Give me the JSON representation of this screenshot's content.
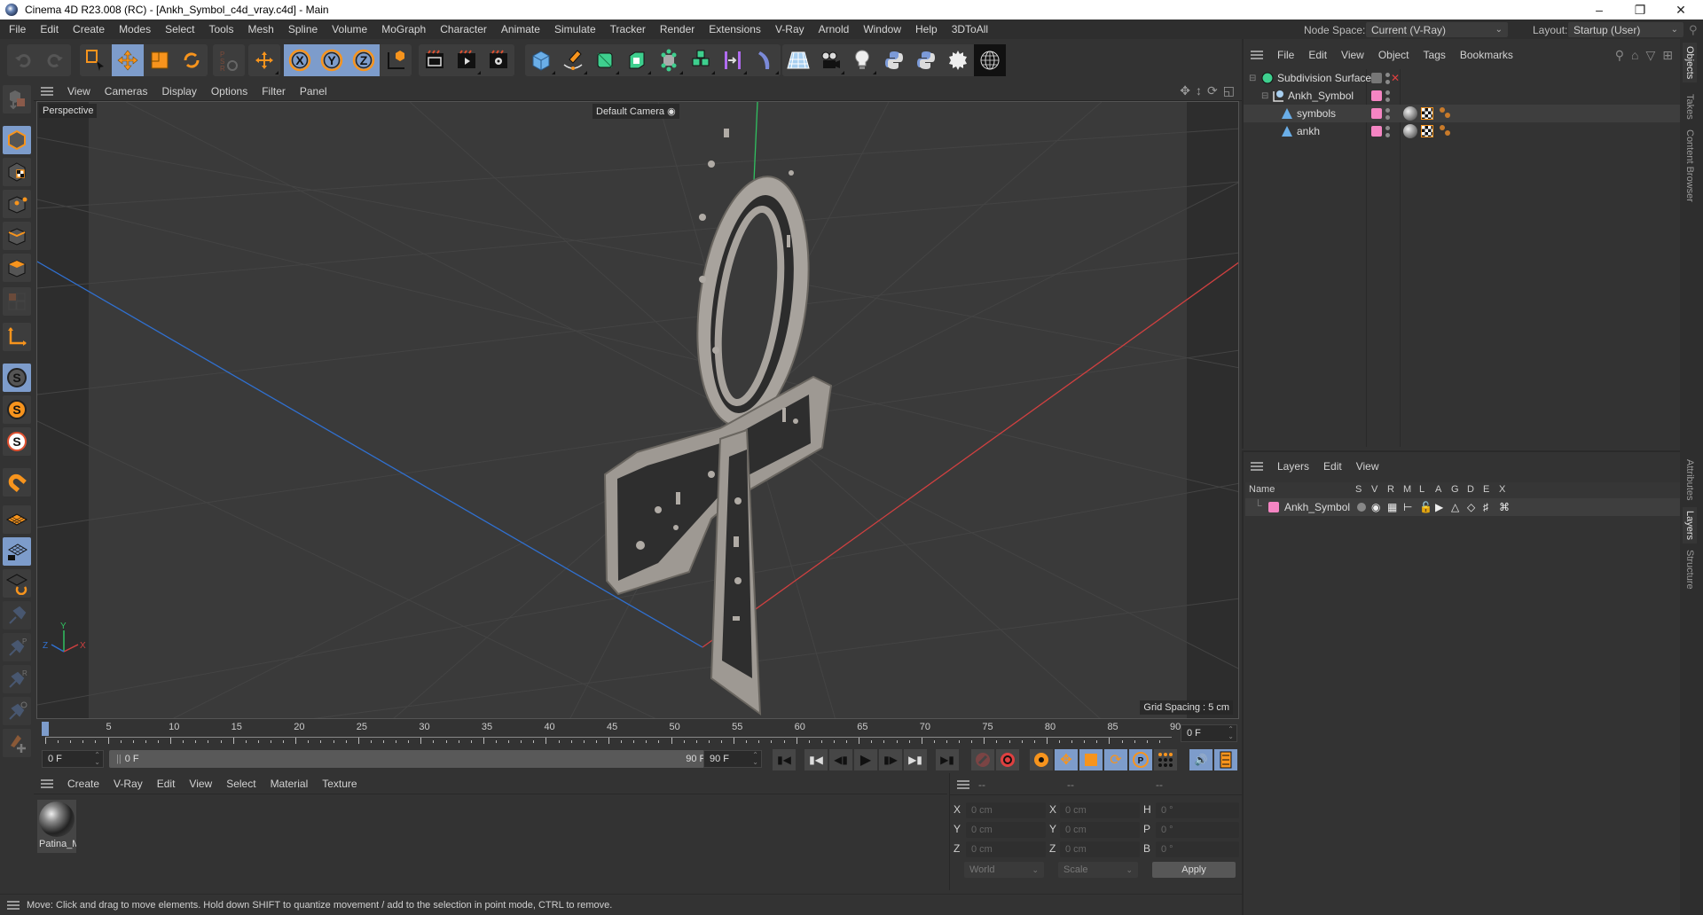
{
  "window": {
    "title": "Cinema 4D R23.008 (RC) - [Ankh_Symbol_c4d_vray.c4d] - Main",
    "controls": [
      "minimize",
      "maximize",
      "close"
    ]
  },
  "menubar": {
    "items": [
      "File",
      "Edit",
      "Create",
      "Modes",
      "Select",
      "Tools",
      "Mesh",
      "Spline",
      "Volume",
      "MoGraph",
      "Character",
      "Animate",
      "Simulate",
      "Tracker",
      "Render",
      "Extensions",
      "V-Ray",
      "Arnold",
      "Window",
      "Help",
      "3DToAll"
    ],
    "node_space_label": "Node Space:",
    "node_space_value": "Current (V-Ray)",
    "layout_label": "Layout:",
    "layout_value": "Startup (User)"
  },
  "toolbar": {
    "groups": [
      [
        "undo-icon",
        "redo-icon"
      ],
      [
        "live-selection-icon",
        "move-icon",
        "scale-icon",
        "rotate-icon"
      ],
      [
        "psr-icon"
      ],
      [
        "world-axis-move-icon"
      ],
      [
        "x-axis-lock-icon",
        "y-axis-lock-icon",
        "z-axis-lock-icon",
        "coordinate-system-icon"
      ],
      [
        "render-view-icon",
        "render-picture-viewer-icon",
        "render-settings-icon"
      ],
      [
        "cube-icon",
        "pen-icon",
        "subdivision-icon",
        "extrude-icon",
        "cloner-icon",
        "mograph-icon",
        "symmetry-icon",
        "deformer-icon"
      ],
      [
        "floor-icon",
        "camera-icon",
        "light-icon",
        "python-icon",
        "python-2-icon",
        "sun-icon",
        "sphere-wireframe-icon"
      ]
    ],
    "active": [
      "move-icon",
      "x-axis-lock-icon",
      "y-axis-lock-icon",
      "z-axis-lock-icon"
    ]
  },
  "left_tools": [
    "make-editable-icon",
    "model-mode-icon",
    "texture-mode-icon",
    "points-mode-icon",
    "edges-mode-icon",
    "polygons-mode-icon",
    "uv-mode-icon",
    "axis-mode-icon",
    "snap-icon",
    "snap-settings-icon",
    "snap-3d-icon",
    "magnet-icon",
    "workplane-icon",
    "workplane-lock-icon",
    "workplane-align-icon",
    "pin-icon",
    "pin-p-icon",
    "pin-r-icon",
    "pin-target-icon",
    "add-pin-icon"
  ],
  "viewport": {
    "menu": [
      "View",
      "Cameras",
      "Display",
      "Options",
      "Filter",
      "Panel"
    ],
    "view_name": "Perspective",
    "camera": "Default Camera",
    "grid_spacing": "Grid Spacing : 5 cm",
    "axis_labels": {
      "x": "X",
      "y": "Y",
      "z": "Z"
    },
    "nav_icons": [
      "pan-icon",
      "dolly-icon",
      "orbit-icon",
      "maximize-view-icon"
    ]
  },
  "timeline": {
    "ticks": [
      "0",
      "5",
      "10",
      "15",
      "20",
      "25",
      "30",
      "35",
      "40",
      "45",
      "50",
      "55",
      "60",
      "65",
      "70",
      "75",
      "80",
      "85",
      "90"
    ],
    "current_frame": "0 F",
    "start": "0 F",
    "range_start": "0 F",
    "range_end": "90 F",
    "end": "90 F",
    "frame_display": "0 F"
  },
  "transport": [
    "go-to-start-icon",
    "prev-key-icon",
    "prev-frame-icon",
    "play-icon",
    "next-frame-icon",
    "next-key-icon",
    "go-to-end-icon",
    "record-icon",
    "autokey-icon",
    "keyframe-settings-icon",
    "key-pos-icon",
    "key-scale-icon",
    "key-rot-icon",
    "key-param-icon",
    "key-pla-icon",
    "sound-icon",
    "timeline-icon"
  ],
  "material_manager": {
    "menu": [
      "Create",
      "V-Ray",
      "Edit",
      "View",
      "Select",
      "Material",
      "Texture"
    ],
    "materials": [
      {
        "name": "Patina_M"
      }
    ]
  },
  "coordinates": {
    "headers": [
      "--",
      "--",
      "--"
    ],
    "rows": [
      {
        "l1": "X",
        "v1": "0 cm",
        "l2": "X",
        "v2": "0 cm",
        "l3": "H",
        "v3": "0 °"
      },
      {
        "l1": "Y",
        "v1": "0 cm",
        "l2": "Y",
        "v2": "0 cm",
        "l3": "P",
        "v3": "0 °"
      },
      {
        "l1": "Z",
        "v1": "0 cm",
        "l2": "Z",
        "v2": "0 cm",
        "l3": "B",
        "v3": "0 °"
      }
    ],
    "space": "World",
    "mode": "Scale",
    "apply": "Apply"
  },
  "object_manager": {
    "menu": [
      "File",
      "Edit",
      "View",
      "Object",
      "Tags",
      "Bookmarks"
    ],
    "objects": [
      {
        "name": "Subdivision Surface",
        "depth": 0,
        "icon": "subdivision-icon"
      },
      {
        "name": "Ankh_Symbol",
        "depth": 1,
        "icon": "null-icon"
      },
      {
        "name": "symbols",
        "depth": 2,
        "icon": "polygon-icon"
      },
      {
        "name": "ankh",
        "depth": 2,
        "icon": "polygon-icon"
      }
    ]
  },
  "layer_manager": {
    "menu": [
      "Layers",
      "Edit",
      "View"
    ],
    "columns": [
      "Name",
      "S",
      "V",
      "R",
      "M",
      "L",
      "A",
      "G",
      "D",
      "E",
      "X"
    ],
    "layers": [
      {
        "name": "Ankh_Symbol",
        "color": "#f585c3"
      }
    ]
  },
  "right_tabs": {
    "top": [
      "Objects",
      "Takes",
      "Content Browser"
    ],
    "bottom": [
      "Attributes",
      "Layers",
      "Structure"
    ],
    "active_top": "Objects",
    "active_bottom": "Layers"
  },
  "status": "Move: Click and drag to move elements. Hold down SHIFT to quantize movement / add to the selection in point mode, CTRL to remove.",
  "colors": {
    "accent": "#7d9ccb",
    "orange": "#f7941d",
    "layer_pink": "#f585c3",
    "x_axis": "#d04040",
    "y_axis": "#30c060",
    "z_axis": "#3070d0"
  }
}
